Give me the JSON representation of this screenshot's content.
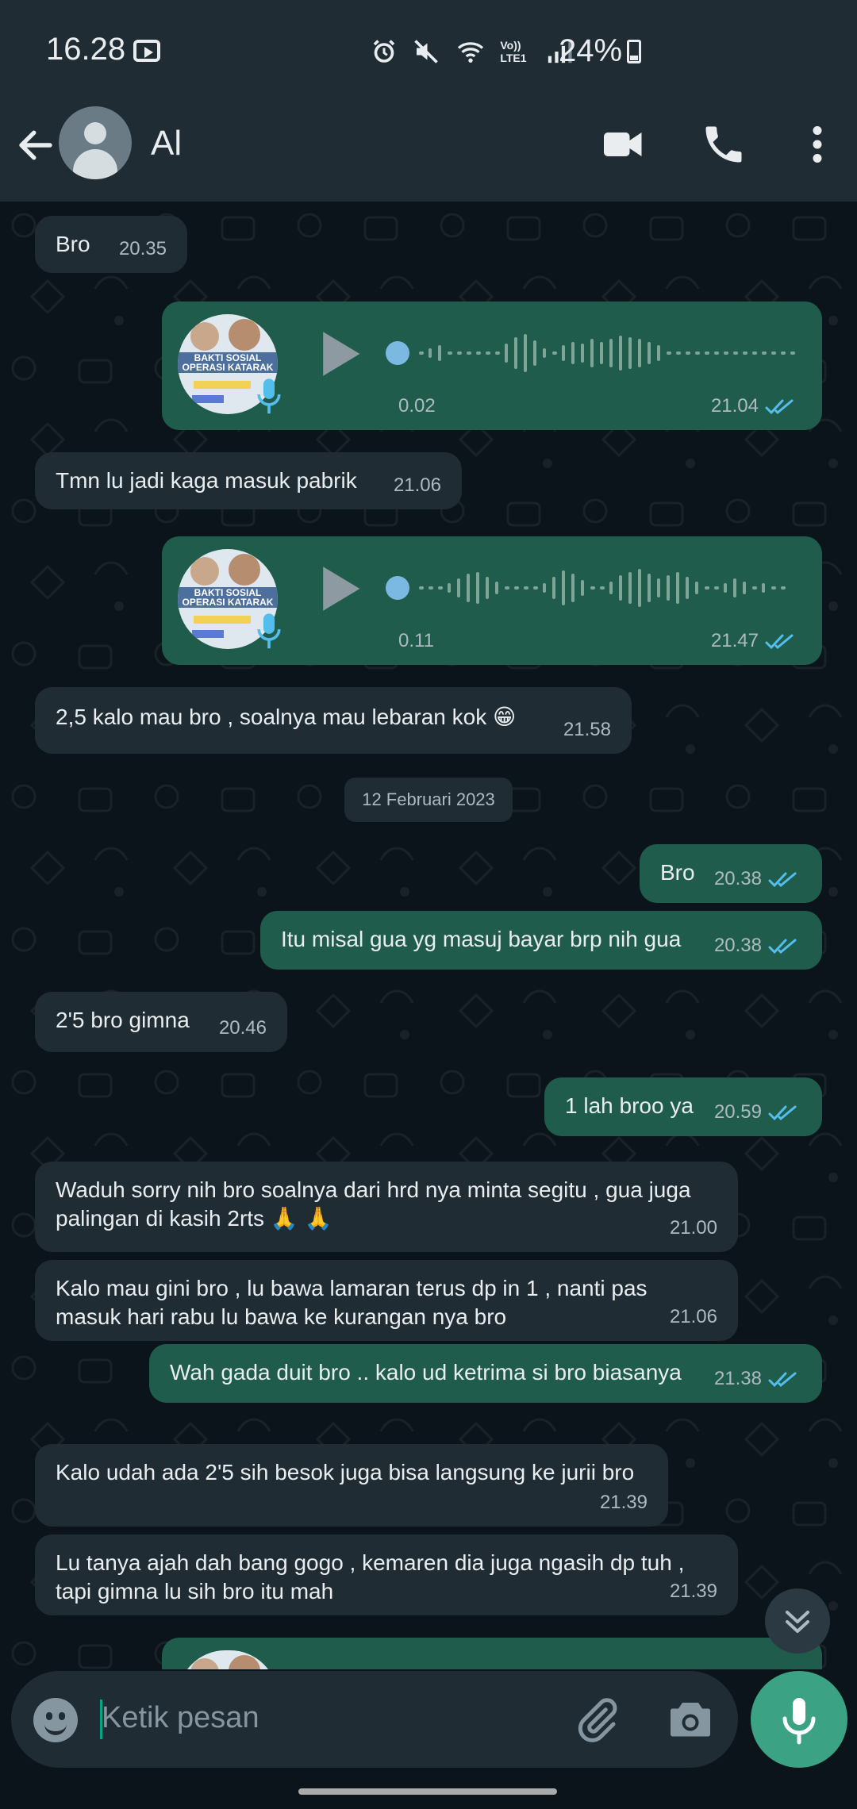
{
  "status_bar": {
    "time": "16.28",
    "network_label": "Vo)) LTE1",
    "battery": "24%"
  },
  "header": {
    "contact_name": "Al"
  },
  "messages": [
    {
      "text": "Bro",
      "time": "20.35"
    },
    {
      "duration": "0.02",
      "time": "21.04",
      "thumb_line1": "BAKTI SOSIAL",
      "thumb_line2": "OPERASI KATARAK"
    },
    {
      "text": "Tmn lu jadi kaga masuk pabrik",
      "time": "21.06"
    },
    {
      "duration": "0.11",
      "time": "21.47",
      "thumb_line1": "BAKTI SOSIAL",
      "thumb_line2": "OPERASI KATARAK"
    },
    {
      "text": "2,5 kalo mau bro , soalnya mau lebaran kok 😁",
      "time": "21.58"
    },
    {
      "date": "12 Februari 2023"
    },
    {
      "text": "Bro",
      "time": "20.38"
    },
    {
      "text": "Itu misal gua yg masuj bayar brp nih gua",
      "time": "20.38"
    },
    {
      "text": "2'5 bro gimna",
      "time": "20.46"
    },
    {
      "text": "1 lah broo ya",
      "time": "20.59"
    },
    {
      "line1": "Waduh sorry nih bro soalnya dari hrd nya minta segitu , gua juga",
      "line2": "palingan di kasih 2rts 🙏 🙏",
      "time": "21.00"
    },
    {
      "line1": "Kalo mau gini bro , lu bawa lamaran terus dp in 1 , nanti pas",
      "line2": "masuk hari rabu lu bawa ke kurangan nya bro",
      "time": "21.06"
    },
    {
      "text": "Wah gada duit bro .. kalo ud ketrima si bro biasanya",
      "time": "21.38"
    },
    {
      "text": "Kalo udah ada 2'5 sih besok juga bisa langsung ke jurii bro",
      "time": "21.39"
    },
    {
      "line1": "Lu tanya ajah dah bang gogo , kemaren dia juga ngasih dp tuh ,",
      "line2": "tapi gimna lu sih bro itu mah",
      "time": "21.39"
    }
  ],
  "composer": {
    "placeholder": "Ketik pesan"
  },
  "icons": {
    "back": "arrow-left-icon",
    "video": "video-camera-icon",
    "call": "phone-icon",
    "menu": "more-vertical-icon",
    "emoji": "emoji-icon",
    "attach": "paperclip-icon",
    "camera": "camera-icon",
    "mic": "microphone-icon",
    "scroll": "double-chevron-down-icon"
  },
  "colors": {
    "incoming": "#202c33",
    "outgoing": "#1f5c4b",
    "accent": "#00a884",
    "read_ticks": "#53bdeb"
  }
}
